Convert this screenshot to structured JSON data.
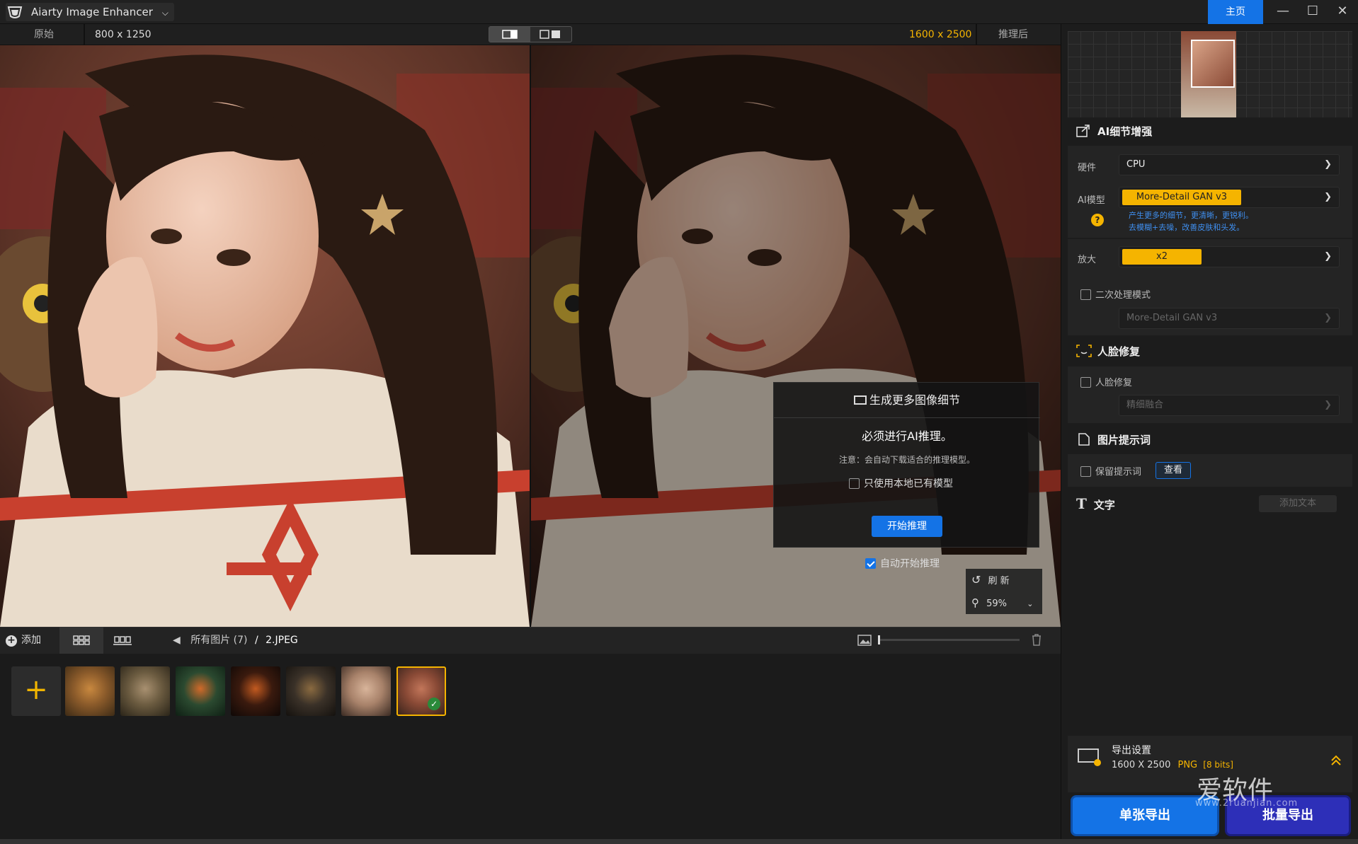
{
  "app": {
    "title": "Aiarty Image Enhancer",
    "home": "主页"
  },
  "subheader": {
    "left_label": "原始",
    "left_size": "800 x 1250",
    "right_size": "1600 x 2500",
    "right_label": "推理后"
  },
  "dialog": {
    "title": "生成更多图像细节",
    "heading": "必须进行AI推理。",
    "note": "注意：会自动下载适合的推理模型。",
    "local_only": "只使用本地已有模型",
    "start": "开始推理"
  },
  "auto_start": "自动开始推理",
  "overlay": {
    "refresh": "刷 新",
    "zoom": "59%"
  },
  "toolbar": {
    "add": "添加",
    "breadcrumb_all": "所有图片 (7)",
    "breadcrumb_sep": "/",
    "breadcrumb_file": "2.JPEG"
  },
  "thumbs": [
    {
      "name": "tiger",
      "colors": [
        "#8a5a2a",
        "#3d2b16",
        "#c8883f"
      ]
    },
    {
      "name": "butterfly",
      "colors": [
        "#6b5b40",
        "#2a2418",
        "#a89070"
      ]
    },
    {
      "name": "fairy-jar",
      "colors": [
        "#2b4a30",
        "#0f1f14",
        "#d06a2a"
      ]
    },
    {
      "name": "burger",
      "colors": [
        "#3a1a0e",
        "#0f0806",
        "#c25a20"
      ]
    },
    {
      "name": "dog-warrior",
      "colors": [
        "#3a3128",
        "#14110e",
        "#8a6a40"
      ]
    },
    {
      "name": "portrait",
      "colors": [
        "#a8826a",
        "#3a2a22",
        "#d8b49a"
      ]
    },
    {
      "name": "girl-current",
      "colors": [
        "#8a4a36",
        "#3a241c",
        "#c2765a"
      ]
    }
  ],
  "ai_detail": {
    "title": "AI细节增强",
    "hardware_label": "硬件",
    "hardware": "CPU",
    "model_label": "AI模型",
    "model": "More-Detail GAN  v3",
    "model_desc_1": "产生更多的细节，更清晰，更锐利。",
    "model_desc_2": "去模糊+去噪，改善皮肤和头发。",
    "scale_label": "放大",
    "scale": "x2",
    "second_pass": "二次处理模式",
    "second_model": "More-Detail GAN  v3"
  },
  "face": {
    "title": "人脸修复",
    "enable": "人脸修复",
    "mode": "精细融合"
  },
  "prompt": {
    "title": "图片提示词",
    "keep": "保留提示词",
    "view": "查看"
  },
  "text": {
    "title": "文字",
    "add": "添加文本"
  },
  "export": {
    "title": "导出设置",
    "size": "1600 X 2500",
    "format": "PNG",
    "bits": "[8 bits]",
    "single": "单张导出",
    "batch": "批量导出"
  },
  "watermark": {
    "main": "爱软件",
    "sub": "www.2ruanjian.com"
  },
  "colors": {
    "accent": "#1473e6",
    "highlight": "#f5b400"
  }
}
